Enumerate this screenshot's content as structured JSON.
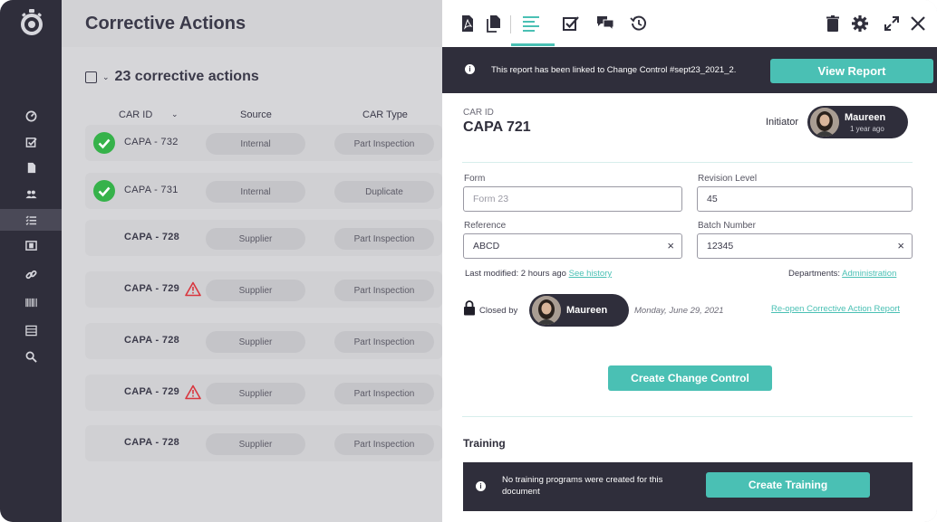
{
  "list": {
    "title": "Corrective Actions",
    "count_label": "23 corrective actions",
    "columns": {
      "car_id": "CAR ID",
      "source": "Source",
      "car_type": "CAR Type"
    },
    "rows": [
      {
        "id": "CAPA - 732",
        "source": "Internal",
        "type": "Part Inspection",
        "status": "done"
      },
      {
        "id": "CAPA - 731",
        "source": "Internal",
        "type": "Duplicate",
        "status": "done"
      },
      {
        "id": "CAPA - 728",
        "source": "Supplier",
        "type": "Part Inspection",
        "status": "none"
      },
      {
        "id": "CAPA - 729",
        "source": "Supplier",
        "type": "Part Inspection",
        "status": "warning"
      },
      {
        "id": "CAPA - 728",
        "source": "Supplier",
        "type": "Part Inspection",
        "status": "none"
      },
      {
        "id": "CAPA - 729",
        "source": "Supplier",
        "type": "Part Inspection",
        "status": "warning"
      },
      {
        "id": "CAPA - 728",
        "source": "Supplier",
        "type": "Part Inspection",
        "status": "none"
      }
    ]
  },
  "nav": {
    "items": [
      "dashboard-icon",
      "checklist-icon",
      "document-icon",
      "users-icon",
      "list-icon",
      "film-icon",
      "link-icon",
      "barcode-icon",
      "server-icon",
      "search-icon"
    ],
    "active": "list-icon"
  },
  "detail": {
    "toolbar": [
      "pdf-icon",
      "copy-icon",
      "details-icon",
      "task-check-icon",
      "comments-icon",
      "history-icon",
      "trash-icon",
      "gear-icon",
      "expand-icon",
      "close-icon"
    ],
    "banner": {
      "message": "This report has been linked to Change Control #sept23_2021_2.",
      "button": "View Report"
    },
    "car_id_label": "CAR ID",
    "car_id": "CAPA 721",
    "initiator_label": "Initiator",
    "initiator": {
      "name": "Maureen",
      "when": "1 year ago"
    },
    "form": {
      "label": "Form",
      "placeholder": "Form 23"
    },
    "revision": {
      "label": "Revision Level",
      "value": "45"
    },
    "reference": {
      "label": "Reference",
      "value": "ABCD"
    },
    "batch": {
      "label": "Batch Number",
      "value": "12345"
    },
    "last_modified": "Last modified: 2 hours ago",
    "see_history": "See history",
    "departments_label": "Departments:",
    "department": "Administration",
    "closed_by_label": "Closed by",
    "closed_by": "Maureen",
    "closed_date": "Monday, June 29, 2021",
    "reopen": "Re-open Corrective Action Report",
    "create_cc": "Create Change Control",
    "training_title": "Training",
    "training_msg": "No training programs were created for this document",
    "create_training": "Create Training"
  },
  "colors": {
    "accent": "#4ac0b4",
    "dark": "#2f2e3b",
    "success": "#36b24a",
    "warning": "#d9363e"
  }
}
